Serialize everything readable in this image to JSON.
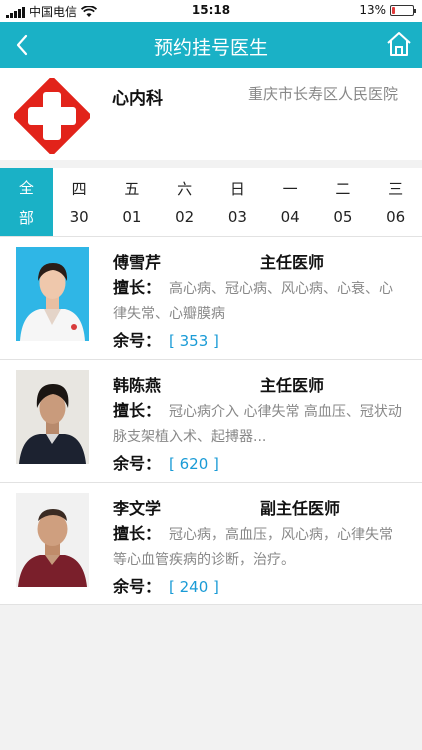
{
  "status_bar": {
    "carrier": "中国电信",
    "time": "15:18",
    "battery": "13%",
    "battery_level": 0.13
  },
  "nav": {
    "title": "预约挂号医生",
    "back_icon": "chevron-left-icon",
    "home_icon": "home-icon"
  },
  "department": {
    "name": "心内科",
    "hospital": "重庆市长寿区人民医院"
  },
  "date_tabs": [
    {
      "top": "全",
      "bottom": "部",
      "active": true
    },
    {
      "top": "四",
      "bottom": "30"
    },
    {
      "top": "五",
      "bottom": "01"
    },
    {
      "top": "六",
      "bottom": "02"
    },
    {
      "top": "日",
      "bottom": "03"
    },
    {
      "top": "一",
      "bottom": "04"
    },
    {
      "top": "二",
      "bottom": "05"
    },
    {
      "top": "三",
      "bottom": "06"
    }
  ],
  "doctors": [
    {
      "name": "傅雪芹",
      "title": "主任医师",
      "specialty_label": "擅长：",
      "specialty": "高心病、冠心病、风心病、心衰、心律失常、心瓣膜病",
      "remaining_label": "余号：",
      "remaining": "[ 353 ]"
    },
    {
      "name": "韩陈燕",
      "title": "主任医师",
      "specialty_label": "擅长：",
      "specialty": "冠心病介入 心律失常 高血压、冠状动脉支架植入术、起搏器...",
      "remaining_label": "余号：",
      "remaining": "[ 620 ]"
    },
    {
      "name": "李文学",
      "title": "副主任医师",
      "specialty_label": "擅长：",
      "specialty": "冠心病，高血压，风心病，心律失常等心血管疾病的诊断，治疗。",
      "remaining_label": "余号：",
      "remaining": "[ 240 ]"
    }
  ],
  "colors": {
    "accent": "#1ab1c6",
    "remaining": "#1a9bd6",
    "logo_red": "#e2231a"
  }
}
